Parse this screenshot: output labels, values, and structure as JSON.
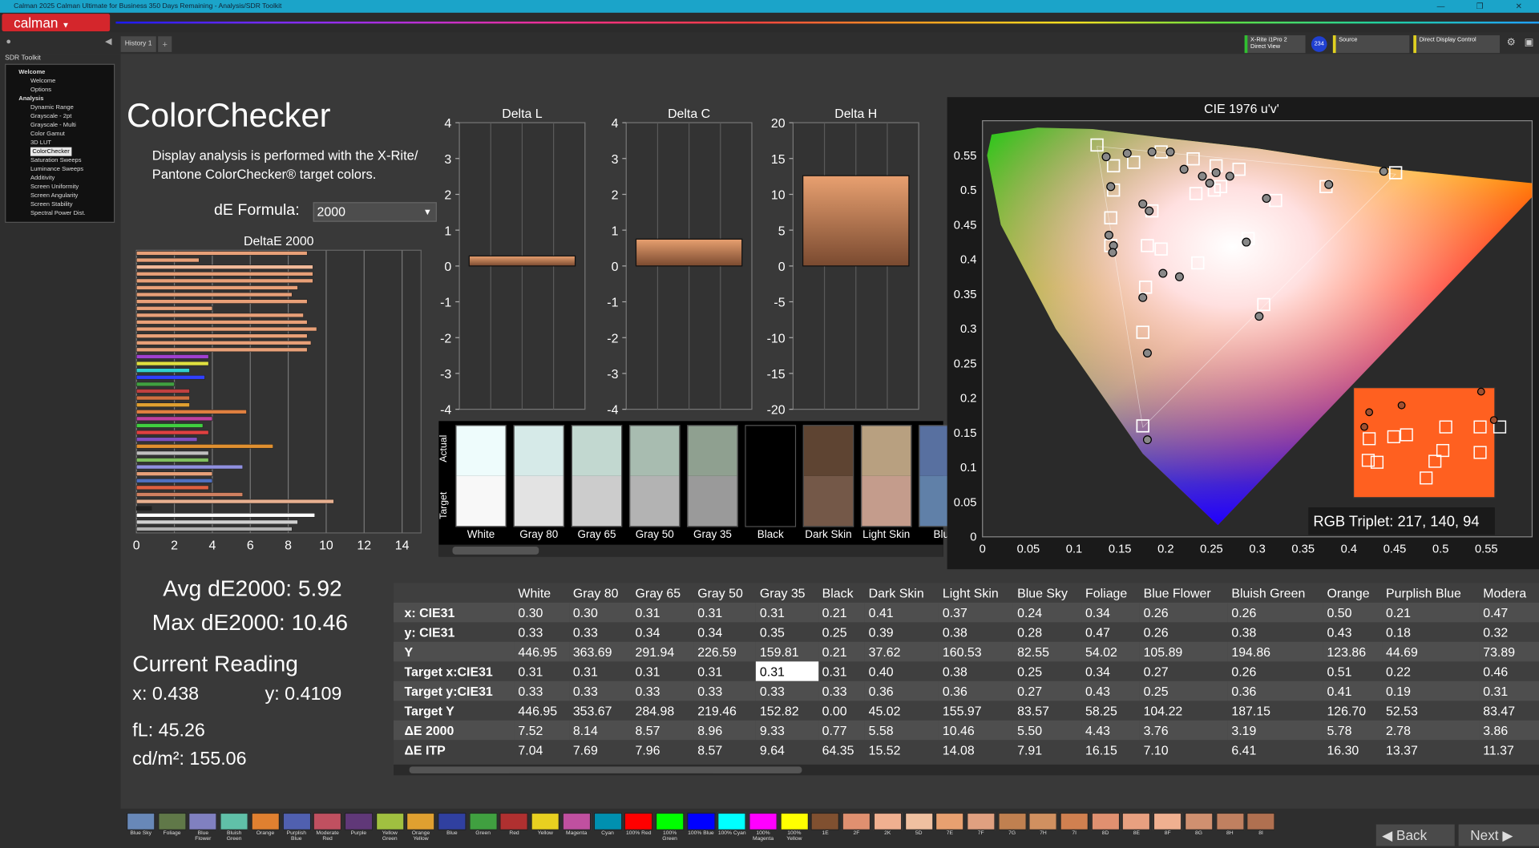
{
  "window": {
    "title": "Calman 2025 Calman Ultimate for Business 350 Days Remaining - Analysis/SDR Toolkit"
  },
  "brand": {
    "logo": "calman"
  },
  "tabs": {
    "history": "History 1",
    "plus": "+"
  },
  "devices": {
    "meter": "X-Rite i1Pro 2",
    "meter_mode": "Direct View",
    "badge": "234",
    "source": "Source",
    "display": "Direct Display Control"
  },
  "sidebar": {
    "header": "SDR Toolkit",
    "items": [
      {
        "label": "Welcome",
        "level": "b"
      },
      {
        "label": "Welcome",
        "level": "i"
      },
      {
        "label": "Options",
        "level": "i"
      },
      {
        "label": "Analysis",
        "level": "b"
      },
      {
        "label": "Dynamic Range",
        "level": "i"
      },
      {
        "label": "Grayscale - 2pt",
        "level": "i"
      },
      {
        "label": "Grayscale - Multi",
        "level": "i"
      },
      {
        "label": "Color Gamut",
        "level": "i"
      },
      {
        "label": "3D LUT",
        "level": "i"
      },
      {
        "label": "ColorChecker",
        "level": "i",
        "selected": true
      },
      {
        "label": "Saturation Sweeps",
        "level": "i"
      },
      {
        "label": "Luminance Sweeps",
        "level": "i"
      },
      {
        "label": "Additivity",
        "level": "i"
      },
      {
        "label": "Screen Uniformity",
        "level": "i"
      },
      {
        "label": "Screen Angularity",
        "level": "i"
      },
      {
        "label": "Screen Stability",
        "level": "i"
      },
      {
        "label": "Spectral Power Dist.",
        "level": "i"
      }
    ]
  },
  "page": {
    "title": "ColorChecker",
    "description": "Display analysis is performed with the X-Rite/ Pantone ColorChecker® target colors.",
    "de_formula_label": "dE Formula:",
    "de_formula_value": "2000"
  },
  "stats": {
    "avg": "Avg dE2000: 5.92",
    "max": "Max dE2000: 10.46",
    "current_reading": "Current Reading",
    "x": "x: 0.438",
    "y": "y: 0.4109",
    "fl": "fL: 45.26",
    "cdm2": "cd/m²: 155.06"
  },
  "chart_data": [
    {
      "type": "bar",
      "title": "DeltaE 2000",
      "orientation": "horizontal",
      "xlim": [
        0,
        15
      ],
      "xticks": [
        "0",
        "2",
        "4",
        "6",
        "8",
        "10",
        "12",
        "14"
      ],
      "values": [
        9.0,
        3.3,
        9.3,
        9.3,
        9.3,
        8.5,
        8.2,
        9.0,
        4.0,
        8.8,
        9.0,
        9.5,
        9.0,
        9.2,
        9.0,
        3.8,
        3.8,
        2.8,
        3.6,
        2.0,
        2.8,
        2.8,
        2.8,
        5.8,
        4.0,
        3.5,
        3.8,
        3.2,
        7.2,
        3.8,
        3.8,
        5.6,
        4.0,
        4.0,
        3.8,
        5.6,
        10.4,
        0.8,
        9.4,
        8.5,
        8.2
      ],
      "colors": [
        "#e8a078",
        "#e8a078",
        "#f0b898",
        "#e8a078",
        "#e8a078",
        "#e8a078",
        "#e8a078",
        "#e8a078",
        "#e8a078",
        "#e8a078",
        "#e8a078",
        "#e8a078",
        "#e8a078",
        "#e8a078",
        "#e8a078",
        "#a040d0",
        "#e0e040",
        "#30d0d0",
        "#3040ff",
        "#40a040",
        "#c04040",
        "#d07040",
        "#e0a030",
        "#e08040",
        "#c040a0",
        "#40d040",
        "#e04040",
        "#8050c0",
        "#e09030",
        "#c0c0c0",
        "#80c060",
        "#9090e0",
        "#e8a078",
        "#5070c0",
        "#e06040",
        "#d08060",
        "#e8b090",
        "#202020",
        "#ffffff",
        "#d0d0d0",
        "#b0b0b0"
      ]
    },
    {
      "type": "bar",
      "title": "Delta L",
      "ylim": [
        -4,
        4
      ],
      "yticks": [
        "4",
        "3",
        "2",
        "1",
        "0",
        "-1",
        "-2",
        "-3",
        "-4"
      ],
      "value": 0.28
    },
    {
      "type": "bar",
      "title": "Delta C",
      "ylim": [
        -4,
        4
      ],
      "yticks": [
        "4",
        "3",
        "2",
        "1",
        "0",
        "-1",
        "-2",
        "-3",
        "-4"
      ],
      "value": 0.75
    },
    {
      "type": "bar",
      "title": "Delta H",
      "ylim": [
        -20,
        20
      ],
      "yticks": [
        "20",
        "15",
        "10",
        "5",
        "0",
        "-5",
        "-10",
        "-15",
        "-20"
      ],
      "value": 12.6
    },
    {
      "type": "scatter",
      "title": "CIE 1976 u'v'",
      "xticks": [
        "0",
        "0.05",
        "0.1",
        "0.15",
        "0.2",
        "0.25",
        "0.3",
        "0.35",
        "0.4",
        "0.45",
        "0.5",
        "0.55"
      ],
      "yticks": [
        "0",
        "0.05",
        "0.1",
        "0.15",
        "0.2",
        "0.25",
        "0.3",
        "0.35",
        "0.4",
        "0.45",
        "0.5",
        "0.55"
      ],
      "xlim": [
        0,
        0.6
      ],
      "ylim": [
        0,
        0.6
      ],
      "targets": [
        [
          0.125,
          0.565
        ],
        [
          0.143,
          0.535
        ],
        [
          0.165,
          0.54
        ],
        [
          0.195,
          0.555
        ],
        [
          0.23,
          0.545
        ],
        [
          0.255,
          0.535
        ],
        [
          0.28,
          0.53
        ],
        [
          0.143,
          0.5
        ],
        [
          0.185,
          0.47
        ],
        [
          0.14,
          0.46
        ],
        [
          0.14,
          0.42
        ],
        [
          0.18,
          0.42
        ],
        [
          0.195,
          0.415
        ],
        [
          0.235,
          0.395
        ],
        [
          0.29,
          0.43
        ],
        [
          0.178,
          0.36
        ],
        [
          0.307,
          0.335
        ],
        [
          0.175,
          0.295
        ],
        [
          0.253,
          0.5
        ],
        [
          0.32,
          0.485
        ],
        [
          0.375,
          0.505
        ],
        [
          0.451,
          0.525
        ],
        [
          0.233,
          0.495
        ],
        [
          0.26,
          0.505
        ],
        [
          0.175,
          0.16
        ]
      ],
      "measured": [
        [
          0.135,
          0.548
        ],
        [
          0.158,
          0.553
        ],
        [
          0.185,
          0.555
        ],
        [
          0.205,
          0.555
        ],
        [
          0.14,
          0.505
        ],
        [
          0.175,
          0.48
        ],
        [
          0.182,
          0.47
        ],
        [
          0.138,
          0.435
        ],
        [
          0.143,
          0.42
        ],
        [
          0.142,
          0.41
        ],
        [
          0.215,
          0.375
        ],
        [
          0.197,
          0.38
        ],
        [
          0.288,
          0.425
        ],
        [
          0.175,
          0.345
        ],
        [
          0.18,
          0.265
        ],
        [
          0.302,
          0.318
        ],
        [
          0.378,
          0.508
        ],
        [
          0.438,
          0.527
        ],
        [
          0.31,
          0.488
        ],
        [
          0.18,
          0.14
        ],
        [
          0.24,
          0.52
        ],
        [
          0.255,
          0.525
        ],
        [
          0.27,
          0.52
        ],
        [
          0.248,
          0.51
        ],
        [
          0.22,
          0.53
        ]
      ],
      "inset_label": "RGB Triplet: 217, 140, 94"
    }
  ],
  "patches": {
    "side_actual": "Actual",
    "side_target": "Target",
    "items": [
      {
        "name": "White",
        "actual": "#eefcfc",
        "target": "#f8f8f8"
      },
      {
        "name": "Gray 80",
        "actual": "#d6eae8",
        "target": "#e3e3e3"
      },
      {
        "name": "Gray 65",
        "actual": "#c2d8d0",
        "target": "#cccccc"
      },
      {
        "name": "Gray 50",
        "actual": "#a8bcb0",
        "target": "#b3b3b3"
      },
      {
        "name": "Gray 35",
        "actual": "#8fa090",
        "target": "#9a9a9a"
      },
      {
        "name": "Black",
        "actual": "#000000",
        "target": "#000000"
      },
      {
        "name": "Dark Skin",
        "actual": "#5e4432",
        "target": "#745848"
      },
      {
        "name": "Light Skin",
        "actual": "#b8a080",
        "target": "#c49c8c"
      },
      {
        "name": "Blue",
        "actual": "#5870a0",
        "target": "#6080a8"
      }
    ]
  },
  "table": {
    "columns": [
      "",
      "White",
      "Gray 80",
      "Gray 65",
      "Gray 50",
      "Gray 35",
      "Black",
      "Dark Skin",
      "Light Skin",
      "Blue Sky",
      "Foliage",
      "Blue Flower",
      "Bluish Green",
      "Orange",
      "Purplish Blue",
      "Modera"
    ],
    "rows": [
      [
        "x: CIE31",
        "0.30",
        "0.30",
        "0.31",
        "0.31",
        "0.31",
        "0.21",
        "0.41",
        "0.37",
        "0.24",
        "0.34",
        "0.26",
        "0.26",
        "0.50",
        "0.21",
        "0.47"
      ],
      [
        "y: CIE31",
        "0.33",
        "0.33",
        "0.34",
        "0.34",
        "0.35",
        "0.25",
        "0.39",
        "0.38",
        "0.28",
        "0.47",
        "0.26",
        "0.38",
        "0.43",
        "0.18",
        "0.32"
      ],
      [
        "Y",
        "446.95",
        "363.69",
        "291.94",
        "226.59",
        "159.81",
        "0.21",
        "37.62",
        "160.53",
        "82.55",
        "54.02",
        "105.89",
        "194.86",
        "123.86",
        "44.69",
        "73.89"
      ],
      [
        "Target x:CIE31",
        "0.31",
        "0.31",
        "0.31",
        "0.31",
        "0.31",
        "0.31",
        "0.40",
        "0.38",
        "0.25",
        "0.34",
        "0.27",
        "0.26",
        "0.51",
        "0.22",
        "0.46"
      ],
      [
        "Target y:CIE31",
        "0.33",
        "0.33",
        "0.33",
        "0.33",
        "0.33",
        "0.33",
        "0.36",
        "0.36",
        "0.27",
        "0.43",
        "0.25",
        "0.36",
        "0.41",
        "0.19",
        "0.31"
      ],
      [
        "Target Y",
        "446.95",
        "353.67",
        "284.98",
        "219.46",
        "152.82",
        "0.00",
        "45.02",
        "155.97",
        "83.57",
        "58.25",
        "104.22",
        "187.15",
        "126.70",
        "52.53",
        "83.47"
      ],
      [
        "ΔE 2000",
        "7.52",
        "8.14",
        "8.57",
        "8.96",
        "9.33",
        "0.77",
        "5.58",
        "10.46",
        "5.50",
        "4.43",
        "3.76",
        "3.19",
        "5.78",
        "2.78",
        "3.86"
      ],
      [
        "ΔE ITP",
        "7.04",
        "7.69",
        "7.96",
        "8.57",
        "9.64",
        "64.35",
        "15.52",
        "14.08",
        "7.91",
        "16.15",
        "7.10",
        "6.41",
        "16.30",
        "13.37",
        "11.37"
      ]
    ]
  },
  "swatches": [
    {
      "l": "Blue Sky",
      "c": "#6888b8"
    },
    {
      "l": "Foliage",
      "c": "#607848"
    },
    {
      "l": "Blue Flower",
      "c": "#8080c0"
    },
    {
      "l": "Bluish Green",
      "c": "#60c0a8"
    },
    {
      "l": "Orange",
      "c": "#e08030"
    },
    {
      "l": "Purplish Blue",
      "c": "#5060b0"
    },
    {
      "l": "Moderate Red",
      "c": "#c05060"
    },
    {
      "l": "Purple",
      "c": "#603878"
    },
    {
      "l": "Yellow Green",
      "c": "#a0c040"
    },
    {
      "l": "Orange Yellow",
      "c": "#e0a030"
    },
    {
      "l": "Blue",
      "c": "#3040a0"
    },
    {
      "l": "Green",
      "c": "#40a040"
    },
    {
      "l": "Red",
      "c": "#b03030"
    },
    {
      "l": "Yellow",
      "c": "#e8d020"
    },
    {
      "l": "Magenta",
      "c": "#c050a0"
    },
    {
      "l": "Cyan",
      "c": "#0090b0"
    },
    {
      "l": "100% Red",
      "c": "#ff0000"
    },
    {
      "l": "100% Green",
      "c": "#00ff00"
    },
    {
      "l": "100% Blue",
      "c": "#0000ff"
    },
    {
      "l": "100% Cyan",
      "c": "#00ffff"
    },
    {
      "l": "100% Magenta",
      "c": "#ff00ff"
    },
    {
      "l": "100% Yellow",
      "c": "#ffff00"
    },
    {
      "l": "1E",
      "c": "#805030"
    },
    {
      "l": "2F",
      "c": "#e09070"
    },
    {
      "l": "2K",
      "c": "#f0b090"
    },
    {
      "l": "5D",
      "c": "#f0c0a0"
    },
    {
      "l": "7E",
      "c": "#e8a070"
    },
    {
      "l": "7F",
      "c": "#e0a080"
    },
    {
      "l": "7G",
      "c": "#c08050"
    },
    {
      "l": "7H",
      "c": "#d09060"
    },
    {
      "l": "7I",
      "c": "#d08050"
    },
    {
      "l": "8D",
      "c": "#e09070"
    },
    {
      "l": "8E",
      "c": "#e8a080"
    },
    {
      "l": "8F",
      "c": "#f0b090"
    },
    {
      "l": "8G",
      "c": "#d09070"
    },
    {
      "l": "8H",
      "c": "#c08060"
    },
    {
      "l": "8I",
      "c": "#b07050"
    }
  ],
  "nav": {
    "back": "Back",
    "next": "Next"
  },
  "colors": {
    "accent": "#d4262c",
    "titlebar": "#1ba4c9"
  }
}
